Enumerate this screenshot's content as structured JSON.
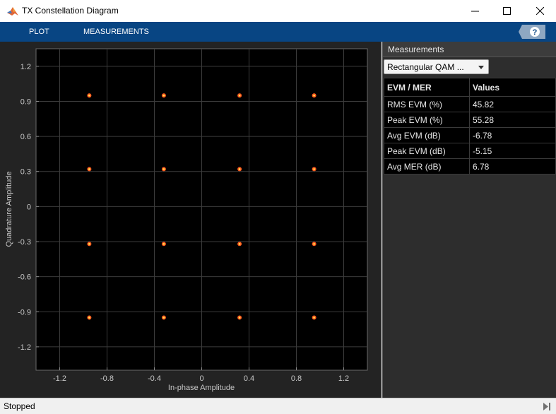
{
  "window": {
    "title": "TX Constellation Diagram",
    "icon": "matlab-logo-icon"
  },
  "menu": {
    "plot_label": "PLOT",
    "measurements_label": "MEASUREMENTS",
    "help_icon": "help-icon"
  },
  "chart_data": {
    "type": "scatter",
    "title": "",
    "xlabel": "In-phase Amplitude",
    "ylabel": "Quadrature Amplitude",
    "xlim": [
      -1.4,
      1.4
    ],
    "ylim": [
      -1.4,
      1.35
    ],
    "xticks": [
      -1.2,
      -0.8,
      -0.4,
      0,
      0.4,
      0.8,
      1.2
    ],
    "xtick_labels": [
      "-1.2",
      "-0.8",
      "-0.4",
      "0",
      "0.4",
      "0.8",
      "1.2"
    ],
    "yticks": [
      1.2,
      0.9,
      0.6,
      0.3,
      0,
      -0.3,
      -0.6,
      -0.9,
      -1.2
    ],
    "ytick_labels": [
      "1.2",
      "0.9",
      "0.6",
      "0.3",
      "0",
      "-0.3",
      "-0.6",
      "-0.9",
      "-1.2"
    ],
    "grid": true,
    "background": "#000000",
    "marker_color": "#ff5a1f",
    "marker_center_color": "#ffe44d",
    "points": [
      {
        "x": -0.95,
        "y": 0.95
      },
      {
        "x": -0.32,
        "y": 0.95
      },
      {
        "x": 0.32,
        "y": 0.95
      },
      {
        "x": 0.95,
        "y": 0.95
      },
      {
        "x": -0.95,
        "y": 0.32
      },
      {
        "x": -0.32,
        "y": 0.32
      },
      {
        "x": 0.32,
        "y": 0.32
      },
      {
        "x": 0.95,
        "y": 0.32
      },
      {
        "x": -0.95,
        "y": -0.32
      },
      {
        "x": -0.32,
        "y": -0.32
      },
      {
        "x": 0.32,
        "y": -0.32
      },
      {
        "x": 0.95,
        "y": -0.32
      },
      {
        "x": -0.95,
        "y": -0.95
      },
      {
        "x": -0.32,
        "y": -0.95
      },
      {
        "x": 0.32,
        "y": -0.95
      },
      {
        "x": 0.95,
        "y": -0.95
      }
    ]
  },
  "measurements": {
    "panel_title": "Measurements",
    "dropdown_value": "Rectangular QAM ...",
    "table": {
      "headers": [
        "EVM / MER",
        "Values"
      ],
      "rows": [
        [
          "RMS EVM (%)",
          "45.82"
        ],
        [
          "Peak EVM (%)",
          "55.28"
        ],
        [
          "Avg EVM (dB)",
          "-6.78"
        ],
        [
          "Peak EVM (dB)",
          "-5.15"
        ],
        [
          "Avg MER (dB)",
          "6.78"
        ]
      ]
    }
  },
  "status": {
    "text": "Stopped",
    "icon": "step-forward-icon"
  }
}
